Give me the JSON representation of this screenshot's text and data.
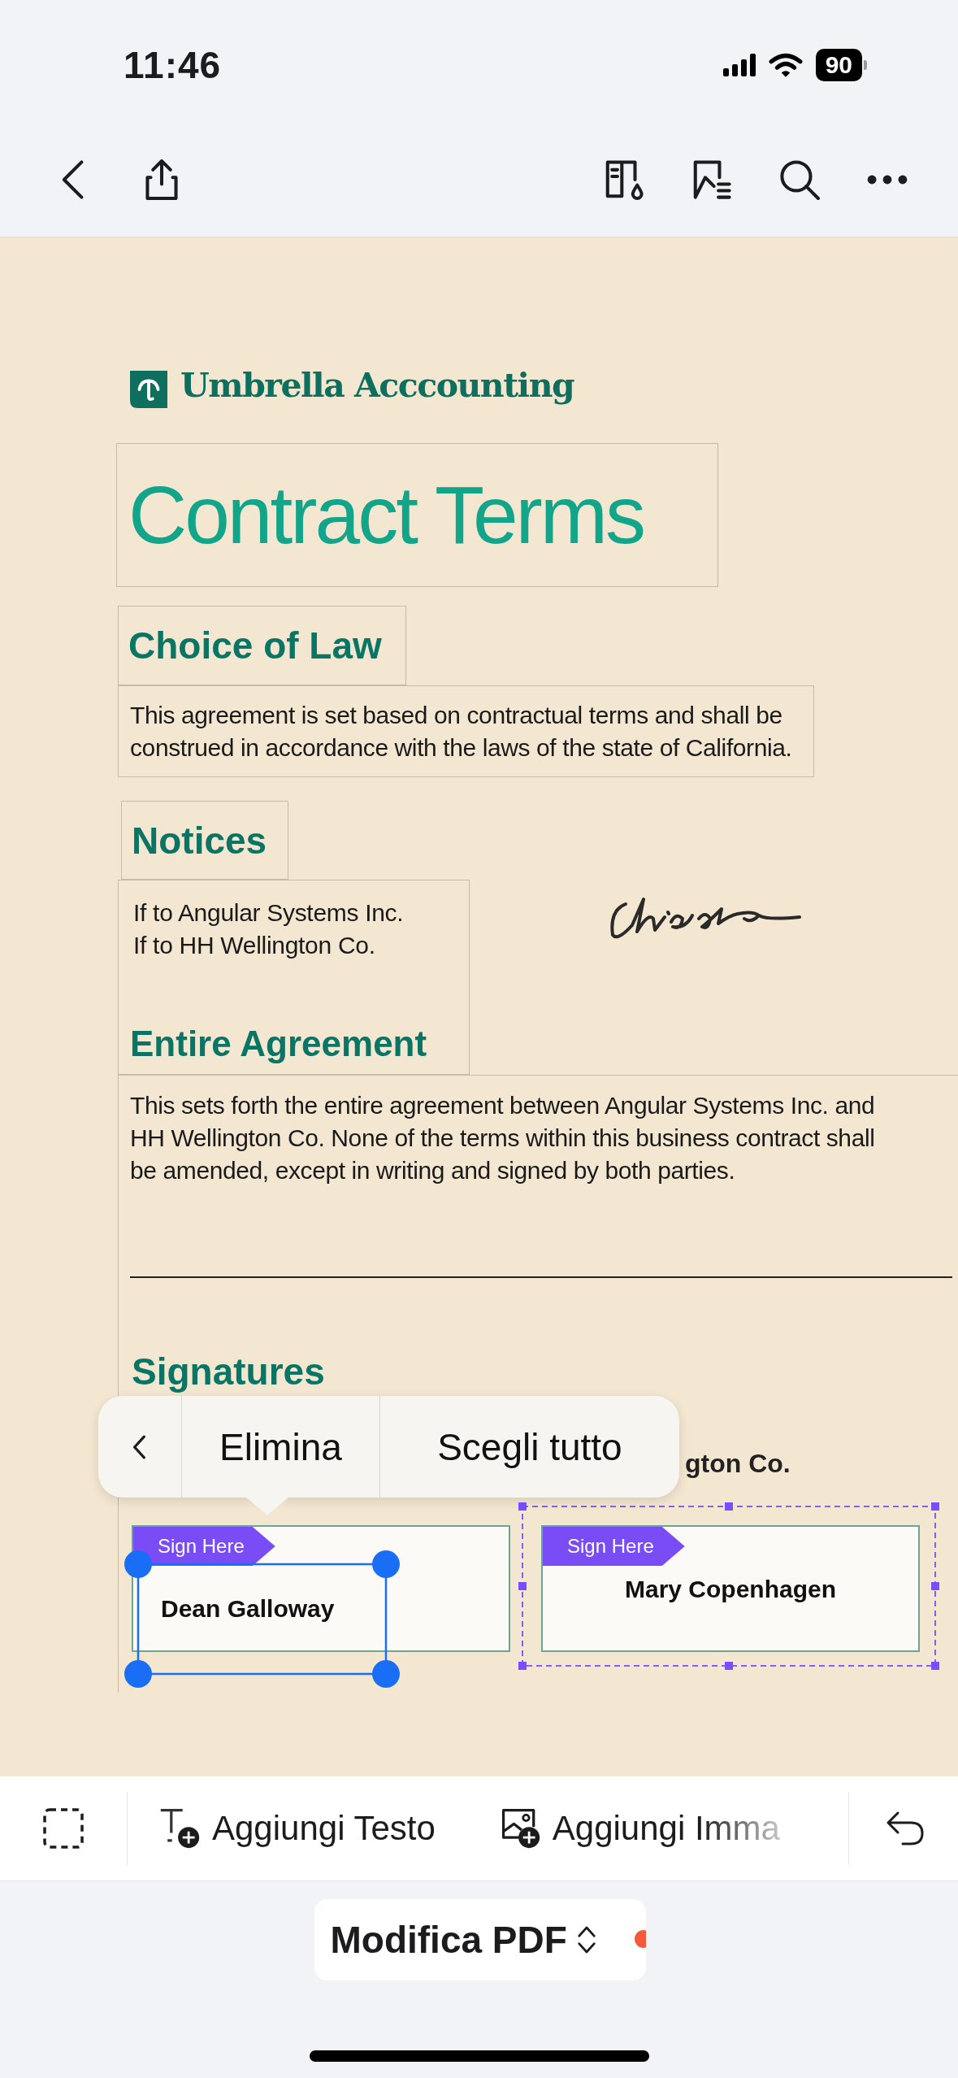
{
  "status_bar": {
    "time": "11:46",
    "battery": "90"
  },
  "document": {
    "logo_text": "Umbrella Acccounting",
    "title": "Contract Terms",
    "choice_of_law": {
      "heading": "Choice of Law",
      "lines": [
        "This agreement is set based on contractual terms and shall be",
        "construed in accordance with the laws of the state of California."
      ]
    },
    "notices": {
      "heading": "Notices",
      "lines": [
        "If to Angular Systems Inc.",
        "If to HH Wellington Co."
      ]
    },
    "entire_agreement": {
      "heading": "Entire Agreement",
      "lines": [
        "This sets forth the entire agreement between Angular Systems Inc. and",
        "HH Wellington Co. None of the terms within this business contract shall",
        "be amended, except in writing and signed by both parties."
      ]
    },
    "signatures_heading": "Signatures",
    "party_fragment": "gton Co.",
    "sign_fields": [
      {
        "tag": "Sign Here",
        "name": "Dean Galloway",
        "text_selected": true,
        "selected": false
      },
      {
        "tag": "Sign Here",
        "name": "Mary Copenhagen",
        "text_selected": false,
        "selected": true
      }
    ]
  },
  "context_menu": {
    "items": [
      {
        "kind": "back"
      },
      {
        "kind": "action",
        "label": "Elimina"
      },
      {
        "kind": "action",
        "label": "Scegli tutto"
      }
    ]
  },
  "bottom_toolbar": {
    "tools": [
      {
        "kind": "select"
      },
      {
        "kind": "text",
        "label": "Aggiungi Testo"
      },
      {
        "kind": "image",
        "label": "Aggiungi Imma",
        "faded": true
      }
    ]
  },
  "mode_button": {
    "label": "Modifica PDF",
    "notification": true
  }
}
